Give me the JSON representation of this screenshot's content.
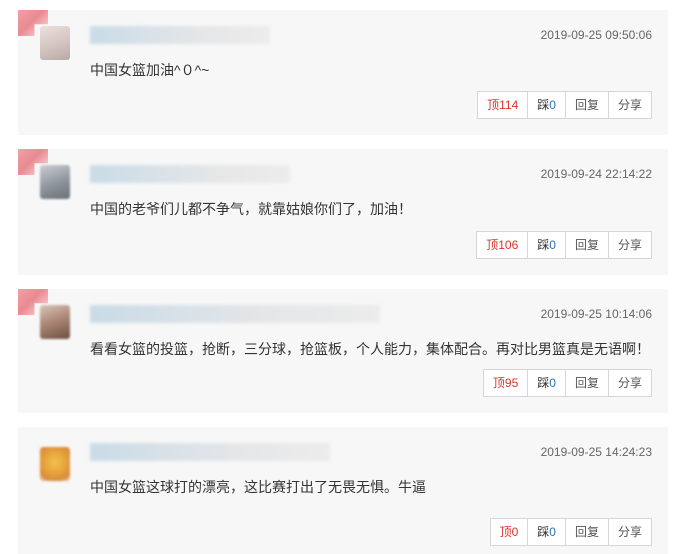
{
  "comments": [
    {
      "time": "2019-09-25 09:50:06",
      "text": "中国女篮加油^０^~",
      "up_label": "顶",
      "up_count": "114",
      "down_label": "踩",
      "down_count": "0",
      "reply_label": "回复",
      "share_label": "分享"
    },
    {
      "time": "2019-09-24 22:14:22",
      "text": "中国的老爷们儿都不争气，就靠姑娘你们了，加油！",
      "up_label": "顶",
      "up_count": "106",
      "down_label": "踩",
      "down_count": "0",
      "reply_label": "回复",
      "share_label": "分享"
    },
    {
      "time": "2019-09-25 10:14:06",
      "text": "看看女篮的投篮，抢断，三分球，抢篮板，个人能力，集体配合。再对比男篮真是无语啊！",
      "up_label": "顶",
      "up_count": "95",
      "down_label": "踩",
      "down_count": "0",
      "reply_label": "回复",
      "share_label": "分享"
    },
    {
      "time": "2019-09-25 14:24:23",
      "text": "中国女篮这球打的漂亮，这比赛打出了无畏无惧。牛逼",
      "up_label": "顶",
      "up_count": "0",
      "down_label": "踩",
      "down_count": "0",
      "reply_label": "回复",
      "share_label": "分享"
    }
  ],
  "colors": {
    "card_bg": "#f7f7f7",
    "up_red": "#d9332c",
    "down_blue": "#2a6fb7",
    "flag_pink": "#e98a91"
  }
}
